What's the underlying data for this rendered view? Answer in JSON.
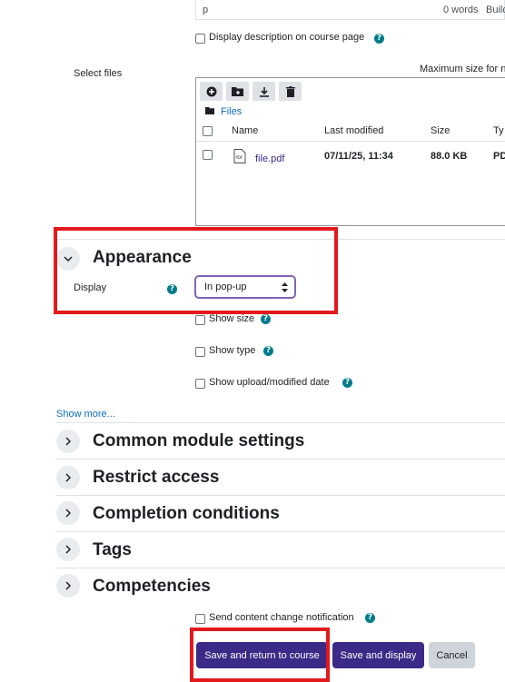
{
  "editor": {
    "path": "p",
    "word_count": "0 words",
    "toolbar_label": "Build"
  },
  "description": {
    "label": "Display description on course page"
  },
  "files": {
    "label": "Select files",
    "max_size": "Maximum size for n",
    "folder": "Files",
    "columns": [
      "Name",
      "Last modified",
      "Size",
      "Ty"
    ],
    "rows": [
      {
        "name": "file.pdf",
        "modified": "07/11/25, 11:34",
        "size": "88.0 KB",
        "type": "PD"
      }
    ]
  },
  "appearance": {
    "title": "Appearance",
    "display_label": "Display",
    "display_value": "In pop-up",
    "options": [
      {
        "label": "Show size"
      },
      {
        "label": "Show type"
      },
      {
        "label": "Show upload/modified date"
      }
    ],
    "show_more": "Show more..."
  },
  "sections": [
    {
      "title": "Common module settings"
    },
    {
      "title": "Restrict access"
    },
    {
      "title": "Completion conditions"
    },
    {
      "title": "Tags"
    },
    {
      "title": "Competencies"
    }
  ],
  "notification": {
    "label": "Send content change notification"
  },
  "buttons": {
    "save_return": "Save and return to course",
    "save_display": "Save and display",
    "cancel": "Cancel"
  },
  "colors": {
    "primary": "#3b2a87",
    "help": "#007c8a",
    "highlight": "#e3191c",
    "select_border": "#8063b8"
  }
}
